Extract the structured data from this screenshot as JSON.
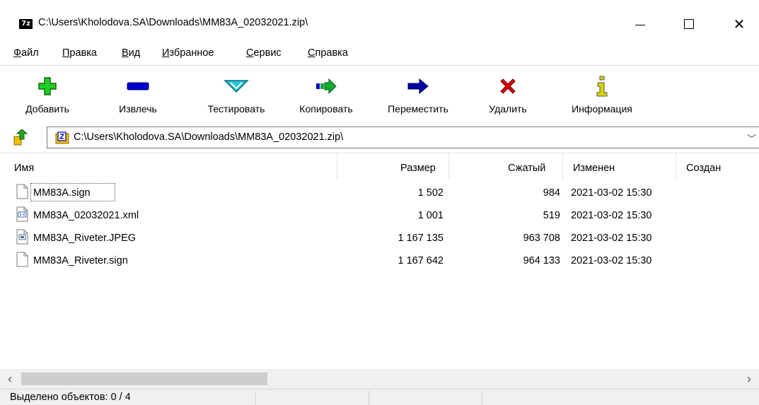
{
  "window": {
    "app_icon_text": "7z",
    "title": "C:\\Users\\Kholodova.SA\\Downloads\\MM83A_02032021.zip\\",
    "minimize_glyph": "—",
    "maximize_glyph": "☐",
    "close_glyph": "✕"
  },
  "menu": [
    "Файл",
    "Правка",
    "Вид",
    "Избранное",
    "Сервис",
    "Справка"
  ],
  "toolbar": [
    {
      "label": "Добавить",
      "icon": "add-icon",
      "color": "#22cc22"
    },
    {
      "label": "Извлечь",
      "icon": "extract-icon",
      "color": "#0000cc"
    },
    {
      "label": "Тестировать",
      "icon": "test-icon",
      "color": "#22c4d8"
    },
    {
      "label": "Копировать",
      "icon": "copy-icon",
      "color": "#11aa33"
    },
    {
      "label": "Переместить",
      "icon": "move-icon",
      "color": "#0000aa"
    },
    {
      "label": "Удалить",
      "icon": "delete-icon",
      "color": "#dd0000"
    },
    {
      "label": "Информация",
      "icon": "info-icon",
      "color": "#d8d800"
    }
  ],
  "address": {
    "path": "C:\\Users\\Kholodova.SA\\Downloads\\MM83A_02032021.zip\\",
    "chevron": "﹀"
  },
  "columns": [
    "Имя",
    "Размер",
    "Сжатый",
    "Изменен",
    "Создан"
  ],
  "files": [
    {
      "name": "MM83A.sign",
      "size": "1 502",
      "packed": "984",
      "modified": "2021-03-02 15:30",
      "created": "",
      "icon": "file-icon"
    },
    {
      "name": "MM83A_02032021.xml",
      "size": "1 001",
      "packed": "519",
      "modified": "2021-03-02 15:30",
      "created": "",
      "icon": "xml-file-icon"
    },
    {
      "name": "MM83A_Riveter.JPEG",
      "size": "1 167 135",
      "packed": "963 708",
      "modified": "2021-03-02 15:30",
      "created": "",
      "icon": "image-file-icon"
    },
    {
      "name": "MM83A_Riveter.sign",
      "size": "1 167 642",
      "packed": "964 133",
      "modified": "2021-03-02 15:30",
      "created": "",
      "icon": "file-icon"
    }
  ],
  "scroll": {
    "left_glyph": "‹",
    "right_glyph": "›"
  },
  "status": {
    "selected": "Выделено объектов: 0 / 4"
  }
}
